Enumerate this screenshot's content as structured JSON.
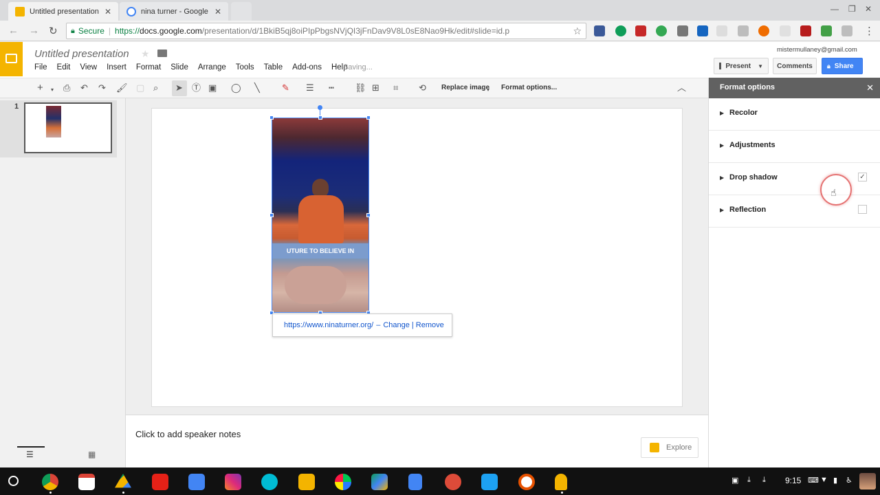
{
  "browser": {
    "tabs": [
      {
        "title": "Untitled presentation - G",
        "active": true,
        "favicon_color": "#f4b400"
      },
      {
        "title": "nina turner - Google Sea",
        "active": false,
        "favicon_color": "#4285f4"
      }
    ],
    "secure_label": "Secure",
    "url_scheme": "https://",
    "url_host": "docs.google.com",
    "url_path": "/presentation/d/1BkiB5qj8oiPIpPbgsNVjQI3jFnDav9V8L0sE8Nao9Hk/edit#slide=id.p"
  },
  "docs": {
    "title": "Untitled presentation",
    "menu": [
      "File",
      "Edit",
      "View",
      "Insert",
      "Format",
      "Slide",
      "Arrange",
      "Tools",
      "Table",
      "Add-ons",
      "Help"
    ],
    "status": "Saving...",
    "account": "mistermullaney@gmail.com",
    "present_label": "Present",
    "comments_label": "Comments",
    "share_label": "Share",
    "accent_color": "#f4b400",
    "share_color": "#4285f4"
  },
  "toolbar": {
    "replace_image_label": "Replace image",
    "format_options_label": "Format options..."
  },
  "filmstrip": {
    "slide_number": "1"
  },
  "slide": {
    "image_banner_text": "UTURE TO BELIEVE IN",
    "link_url": "https://www.ninaturner.org/",
    "link_dash": "–",
    "link_change": "Change",
    "link_sep": "|",
    "link_remove": "Remove"
  },
  "notes": {
    "placeholder": "Click to add speaker notes",
    "explore_label": "Explore"
  },
  "format_panel": {
    "title": "Format options",
    "sections": [
      {
        "label": "Recolor",
        "has_checkbox": false
      },
      {
        "label": "Adjustments",
        "has_checkbox": false
      },
      {
        "label": "Drop shadow",
        "has_checkbox": true,
        "checked": true
      },
      {
        "label": "Reflection",
        "has_checkbox": true,
        "checked": false
      }
    ]
  },
  "shelf": {
    "clock": "9:15"
  }
}
